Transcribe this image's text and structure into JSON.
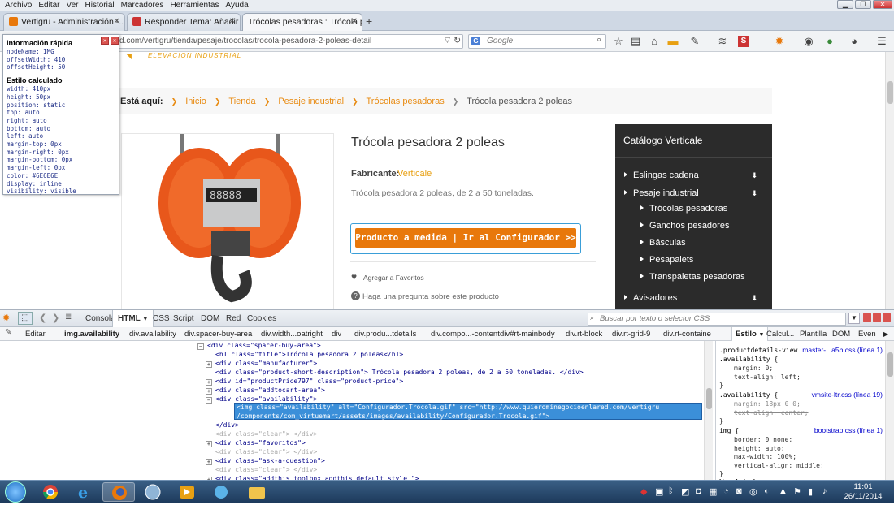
{
  "menubar": {
    "items": [
      "Archivo",
      "Editar",
      "Ver",
      "Historial",
      "Marcadores",
      "Herramientas",
      "Ayuda"
    ]
  },
  "tabs": [
    {
      "title": "Vertigru - Administración -...",
      "icon_color": "#e8780b"
    },
    {
      "title": "Responder Tema: Añadir e...",
      "icon_color": "#c33"
    },
    {
      "title": "Trócolas pesadoras : Trócola p...",
      "icon_color": "#c33"
    }
  ],
  "navbar": {
    "url": "d.com/vertigru/tienda/pesaje/trocolas/trocola-pesadora-2-poleas-detail",
    "search_engine": "Google",
    "search_placeholder": "Google"
  },
  "quickinfo": {
    "title": "Información rápida",
    "lines1": [
      "nodeName: IMG",
      "offsetWidth: 410",
      "offsetHeight: 50"
    ],
    "title2": "Estilo calculado",
    "lines2": [
      "width: 410px",
      "height: 50px",
      "position: static",
      "top: auto",
      "right: auto",
      "bottom: auto",
      "left: auto",
      "margin-top: 0px",
      "margin-right: 0px",
      "margin-bottom: 0px",
      "margin-left: 0px",
      "color: #6E6E6E",
      "display: inline",
      "visibility: visible"
    ]
  },
  "page": {
    "logo_tagline": "ELEVACION INDUSTRIAL",
    "breadcrumb_label": "Está aquí:",
    "breadcrumbs": [
      "Inicio",
      "Tienda",
      "Pesaje industrial",
      "Trócolas pesadoras"
    ],
    "breadcrumb_current": "Trócola pesadora 2 poleas",
    "product_title": "Trócola pesadora 2 poleas",
    "manufacturer_label": "Fabricante:",
    "manufacturer_value": "Verticale",
    "description": "Trócola pesadora 2 poleas, de 2 a 50 toneladas.",
    "config_button": "Producto a medida | Ir al Configurador >>",
    "favorites": "Agregar a Favoritos",
    "question": "Haga una pregunta sobre este producto",
    "catalog_title": "Catálogo Verticale",
    "catalog": [
      {
        "label": "Eslingas cadena",
        "level": 0,
        "arrow": true
      },
      {
        "label": "Pesaje industrial",
        "level": 0,
        "arrow": true
      },
      {
        "label": "Trócolas pesadoras",
        "level": 1,
        "arrow": false
      },
      {
        "label": "Ganchos pesadores",
        "level": 1,
        "arrow": false
      },
      {
        "label": "Básculas",
        "level": 1,
        "arrow": false
      },
      {
        "label": "Pesapalets",
        "level": 1,
        "arrow": false
      },
      {
        "label": "Transpaletas pesadoras",
        "level": 1,
        "arrow": false
      },
      {
        "label": "Avisadores",
        "level": 0,
        "arrow": true
      }
    ]
  },
  "firebug": {
    "tabs": [
      "Consola",
      "HTML",
      "CSS",
      "Script",
      "DOM",
      "Red",
      "Cookies"
    ],
    "search_placeholder": "Buscar por texto o selector CSS",
    "edit_label": "Editar",
    "crumbs": [
      "img.availability",
      "div.availability",
      "div.spacer-buy-area",
      "div.width...oatright",
      "div",
      "div.produ...tdetails",
      "div.compo...-content",
      "div#rt-mainbody",
      "div.rt-block",
      "div.rt-grid-9",
      "div.rt-containe"
    ],
    "side_tabs": [
      "Estilo",
      "Calcul...",
      "Plantilla",
      "DOM",
      "Even"
    ],
    "code": [
      {
        "indent": 0,
        "toggle": "minus",
        "html": "<div class=\"spacer-buy-area\">",
        "dim": false
      },
      {
        "indent": 1,
        "toggle": "",
        "html": "<h1 class=\"title\">Trócola pesadora 2 poleas</h1>",
        "dim": false
      },
      {
        "indent": 1,
        "toggle": "plus",
        "html": "<div class=\"manufacturer\">",
        "dim": false
      },
      {
        "indent": 1,
        "toggle": "",
        "html": "<div class=\"product-short-description\"> Trócola pesadora 2 poleas, de 2 a 50 toneladas. </div>",
        "dim": false
      },
      {
        "indent": 1,
        "toggle": "plus",
        "html": "<div id=\"productPrice797\" class=\"product-price\">",
        "dim": false
      },
      {
        "indent": 1,
        "toggle": "plus",
        "html": "<div class=\"addtocart-area\">",
        "dim": false
      },
      {
        "indent": 1,
        "toggle": "minus",
        "html": "<div class=\"availability\">",
        "dim": false
      },
      {
        "indent": 2,
        "toggle": "sel",
        "html": "<img class=\"availability\" alt=\"Configurador.Trocola.gif\" src=\"http://www.quierominegocioenlared.com/vertigru",
        "dim": false
      },
      {
        "indent": 2,
        "toggle": "sel2",
        "html": "/components/com_virtuemart/assets/images/availability/Configurador.Trocola.gif\">",
        "dim": false
      },
      {
        "indent": 1,
        "toggle": "",
        "html": "</div>",
        "dim": false
      },
      {
        "indent": 1,
        "toggle": "",
        "html": "<div class=\"clear\"> </div>",
        "dim": true
      },
      {
        "indent": 1,
        "toggle": "plus",
        "html": "<div class=\"favoritos\">",
        "dim": false
      },
      {
        "indent": 1,
        "toggle": "",
        "html": "<div class=\"clear\"> </div>",
        "dim": true
      },
      {
        "indent": 1,
        "toggle": "plus",
        "html": "<div class=\"ask-a-question\">",
        "dim": false
      },
      {
        "indent": 1,
        "toggle": "",
        "html": "<div class=\"clear\"> </div>",
        "dim": true
      },
      {
        "indent": 1,
        "toggle": "plus",
        "html": "<div class=\"addthis_toolbox addthis_default_style \">",
        "dim": false
      }
    ],
    "style_rules": [
      {
        "selector": ".productdetails-view .availability {",
        "source": "master-...a5b.css (línea 1)",
        "props": [
          {
            "t": "margin: 0;",
            "s": false
          },
          {
            "t": "text-align: left;",
            "s": false
          }
        ]
      },
      {
        "selector": ".availability {",
        "source": "vmsite-ltr.css (línea 19)",
        "props": [
          {
            "t": "margin: 18px 0 0;",
            "s": true
          },
          {
            "t": "text-align: center;",
            "s": true
          }
        ]
      },
      {
        "selector": "img {",
        "source": "bootstrap.css (línea 1)",
        "props": [
          {
            "t": "border: 0 none;",
            "s": false
          },
          {
            "t": "height: auto;",
            "s": false
          },
          {
            "t": "max-width: 100%;",
            "s": false
          },
          {
            "t": "vertical-align: middle;",
            "s": false
          }
        ]
      }
    ],
    "style_footer": "Heredado de"
  },
  "taskbar": {
    "time": "11:01",
    "date": "26/11/2014"
  }
}
